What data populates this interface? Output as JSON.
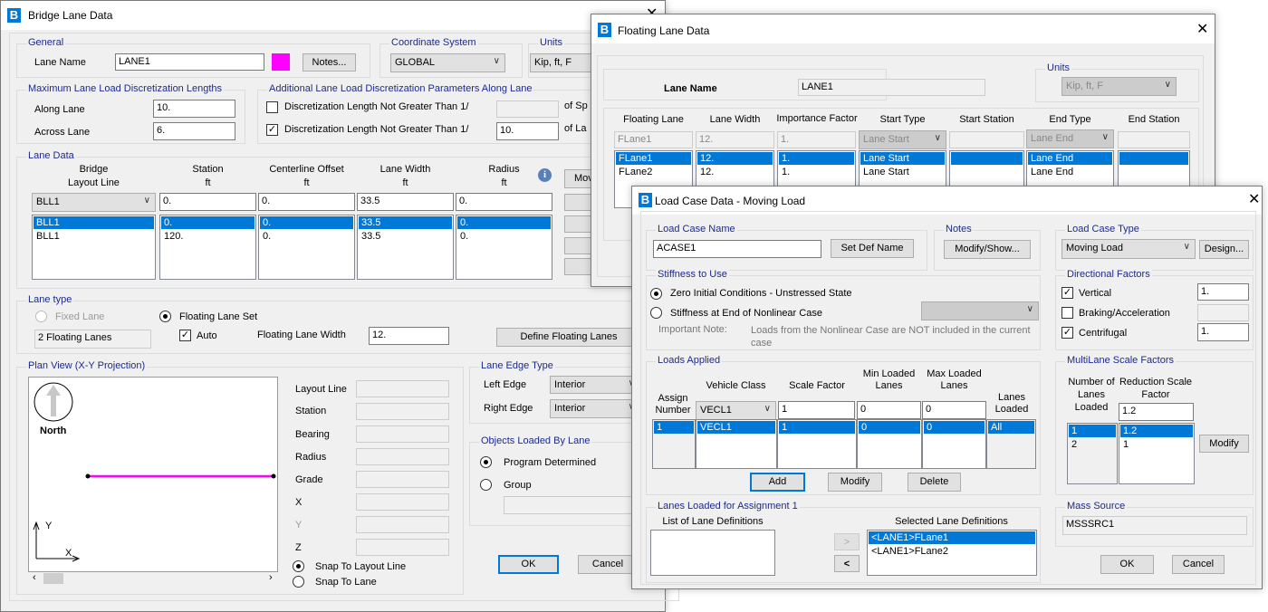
{
  "bridge_lane": {
    "title": "Bridge Lane Data",
    "general": {
      "legend": "General",
      "lane_name_label": "Lane Name",
      "lane_name": "LANE1",
      "lane_color": "#ff00ff",
      "notes_button": "Notes..."
    },
    "coord": {
      "legend": "Coordinate System",
      "value": "GLOBAL"
    },
    "units": {
      "legend": "Units",
      "value": "Kip, ft, F"
    },
    "max_disc": {
      "legend": "Maximum Lane Load Discretization Lengths",
      "along_label": "Along Lane",
      "along": "10.",
      "across_label": "Across Lane",
      "across": "6."
    },
    "add_disc": {
      "legend": "Additional Lane Load Discretization Parameters Along Lane",
      "row1_label": "Discretization Length Not Greater Than  1/",
      "row1_checked": false,
      "row1_value": "",
      "row1_suffix": "of Sp",
      "row2_label": "Discretization Length Not Greater Than  1/",
      "row2_checked": true,
      "row2_value": "10.",
      "row2_suffix": "of La"
    },
    "lane_data": {
      "legend": "Lane Data",
      "headers": [
        [
          "Bridge",
          "Layout Line"
        ],
        [
          "Station",
          "ft"
        ],
        [
          "Centerline Offset",
          "ft"
        ],
        [
          "Lane Width",
          "ft"
        ],
        [
          "Radius",
          "ft"
        ]
      ],
      "edit_row": [
        "BLL1",
        "0.",
        "0.",
        "33.5",
        "0."
      ],
      "rows": [
        [
          "BLL1",
          "0.",
          "0.",
          "33.5",
          "0."
        ],
        [
          "BLL1",
          "120.",
          "0.",
          "33.5",
          "0."
        ]
      ],
      "move_button": "Mov"
    },
    "lane_type": {
      "legend": "Lane type",
      "fixed_label": "Fixed Lane",
      "floating_label": "Floating Lane Set",
      "floating_count": "2 Floating Lanes",
      "auto_label": "Auto",
      "auto_checked": true,
      "width_label": "Floating Lane Width",
      "width": "12.",
      "define_button": "Define Floating Lanes"
    },
    "plan": {
      "legend": "Plan View (X-Y Projection)",
      "north": "North",
      "axis_x": "X",
      "axis_y": "Y",
      "lane_color": "#ff00ff",
      "fields": [
        "Layout Line",
        "Station",
        "Bearing",
        "Radius",
        "Grade",
        "X",
        "Y",
        "Z"
      ],
      "snap_layout": "Snap To Layout Line",
      "snap_lane": "Snap To Lane"
    },
    "edge": {
      "legend": "Lane Edge Type",
      "left_label": "Left Edge",
      "left": "Interior",
      "right_label": "Right Edge",
      "right": "Interior"
    },
    "objects": {
      "legend": "Objects Loaded By Lane",
      "program": "Program Determined",
      "group": "Group"
    },
    "ok": "OK",
    "cancel": "Cancel"
  },
  "floating": {
    "title": "Floating Lane Data",
    "lane_name_label": "Lane Name",
    "lane_name": "LANE1",
    "units_legend": "Units",
    "units": "Kip, ft, F",
    "headers": [
      "Floating Lane",
      "Lane Width",
      "Importance Factor",
      "Start Type",
      "Start Station",
      "End Type",
      "End Station"
    ],
    "edit_row": [
      "FLane1",
      "12.",
      "1.",
      "Lane Start",
      "",
      "Lane End",
      ""
    ],
    "rows": [
      [
        "FLane1",
        "12.",
        "1.",
        "Lane Start",
        "",
        "Lane End",
        ""
      ],
      [
        "FLane2",
        "12.",
        "1.",
        "Lane Start",
        "",
        "Lane End",
        ""
      ]
    ]
  },
  "load_case": {
    "title": "Load Case Data - Moving Load",
    "name": {
      "legend": "Load Case Name",
      "value": "ACASE1",
      "set_def": "Set Def Name"
    },
    "notes": {
      "legend": "Notes",
      "button": "Modify/Show..."
    },
    "type": {
      "legend": "Load Case Type",
      "value": "Moving Load",
      "design": "Design..."
    },
    "stiffness": {
      "legend": "Stiffness to Use",
      "zero": "Zero Initial Conditions - Unstressed State",
      "nonlinear": "Stiffness at End of Nonlinear Case",
      "note_label": "Important Note:",
      "note": "Loads from the Nonlinear Case are NOT included in the current case"
    },
    "directional": {
      "legend": "Directional Factors",
      "vertical": "Vertical",
      "vertical_value": "1.",
      "braking": "Braking/Acceleration",
      "centrifugal": "Centrifugal",
      "centrifugal_value": "1."
    },
    "loads": {
      "legend": "Loads Applied",
      "h_assign": [
        "Assign",
        "Number"
      ],
      "h_vehicle": "Vehicle Class",
      "h_scale": "Scale Factor",
      "h_min": [
        "Min Loaded",
        "Lanes"
      ],
      "h_max": [
        "Max Loaded",
        "Lanes"
      ],
      "h_lanes": [
        "Lanes",
        "Loaded"
      ],
      "edit_row": {
        "vehicle": "VECL1",
        "scale": "1",
        "min": "0",
        "max": "0"
      },
      "rows": [
        {
          "assign": "1",
          "vehicle": "VECL1",
          "scale": "1",
          "min": "0",
          "max": "0",
          "lanes": "All"
        }
      ],
      "add": "Add",
      "modify": "Modify",
      "delete": "Delete"
    },
    "lanes_loaded": {
      "legend": "Lanes Loaded for Assignment 1",
      "list_label": "List of Lane Definitions",
      "selected_label": "Selected Lane Definitions",
      "add_arrow": ">",
      "remove_arrow": "<",
      "selected": [
        "<LANE1>FLane1",
        "<LANE1>FLane2"
      ]
    },
    "multilane": {
      "legend": "MultiLane Scale Factors",
      "h_num": [
        "Number of",
        "Lanes",
        "Loaded"
      ],
      "h_red": [
        "Reduction Scale",
        "Factor"
      ],
      "edit": "1.2",
      "rows": [
        [
          "1",
          "1.2"
        ],
        [
          "2",
          "1"
        ]
      ],
      "modify": "Modify"
    },
    "mass": {
      "legend": "Mass Source",
      "value": "MSSSRC1"
    },
    "ok": "OK",
    "cancel": "Cancel"
  }
}
